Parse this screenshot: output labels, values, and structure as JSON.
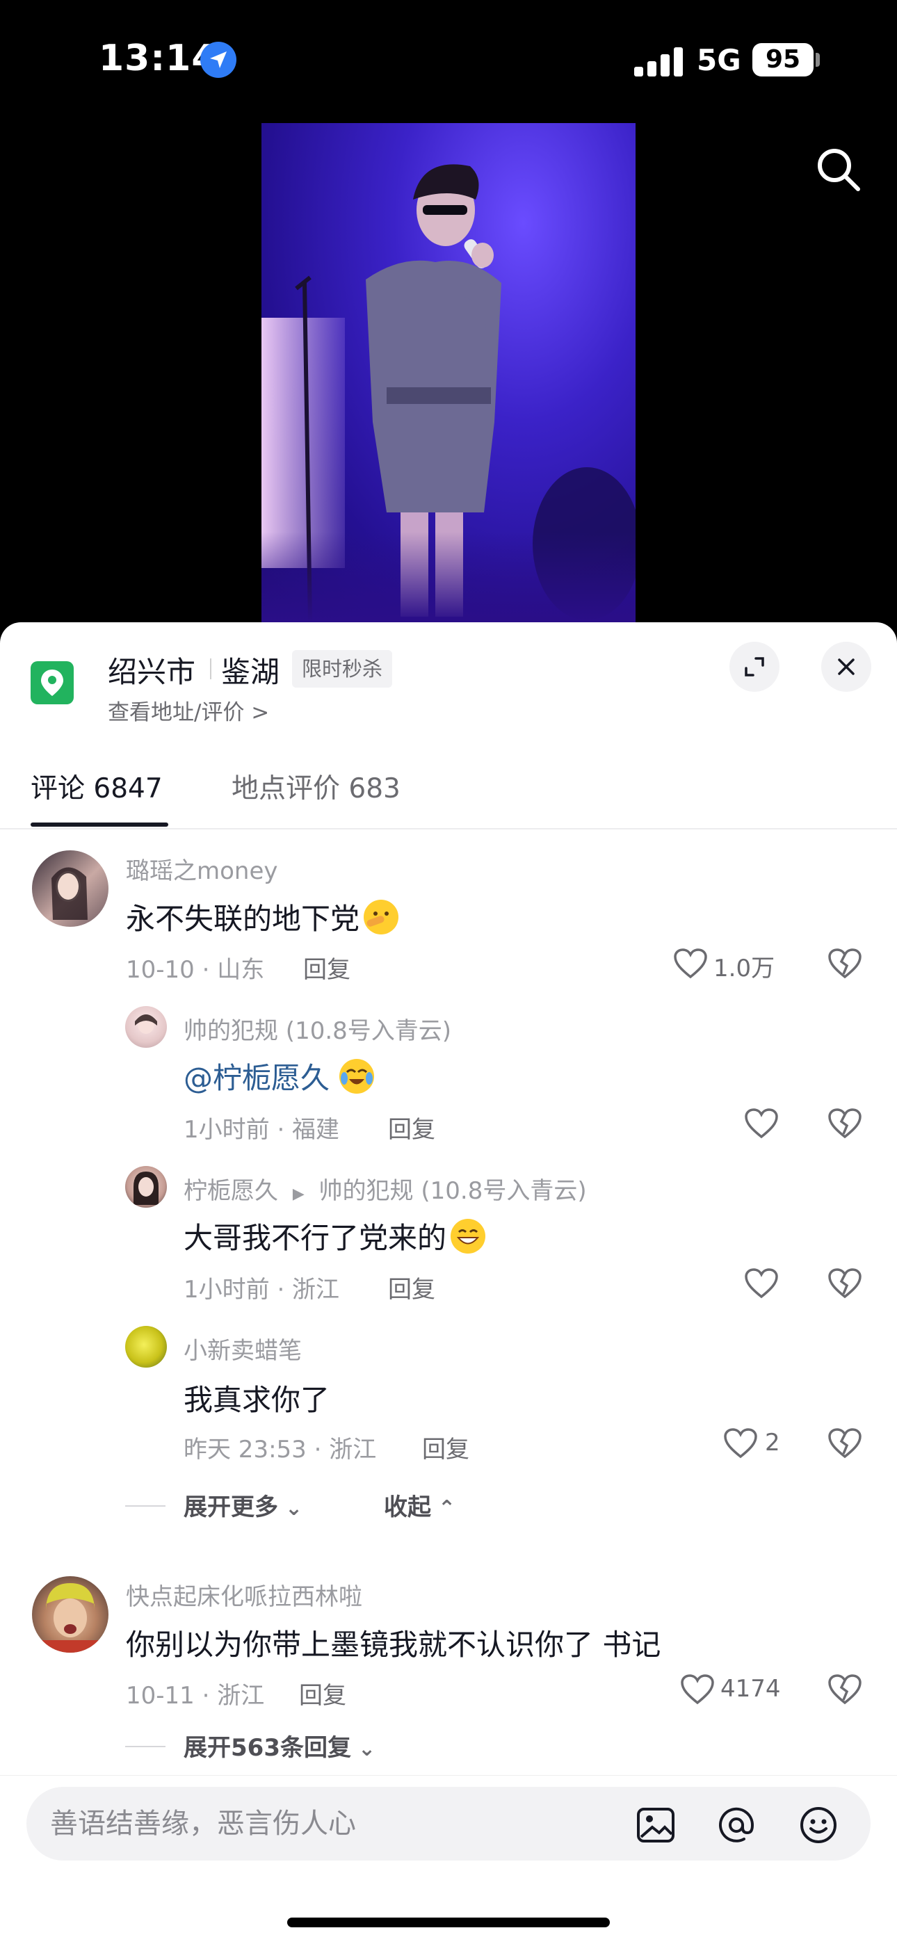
{
  "status_bar": {
    "time": "13:14",
    "network": "5G",
    "battery": "95"
  },
  "poi": {
    "city": "绍兴市",
    "area": "鉴湖",
    "tag": "限时秒杀",
    "link": "查看地址/评价 >"
  },
  "tabs": [
    {
      "label": "评论 6847"
    },
    {
      "label": "地点评价 683"
    }
  ],
  "comments": [
    {
      "user": "璐瑶之money",
      "text": "永不失联的地下党",
      "date": "10-10 · 山东",
      "reply": "回复",
      "likes": "1.0万"
    },
    {
      "user": "快点起床化哌拉西林啦",
      "text": "你别以为你带上墨镜我就不认识你了 书记",
      "date": "10-11 · 浙江",
      "reply": "回复",
      "likes": "4174"
    }
  ],
  "replies": [
    {
      "user": "帅的犯规 (10.8号入青云)",
      "text": "@柠栀愿久",
      "date": "1小时前 · 福建",
      "reply": "回复",
      "likes": ""
    },
    {
      "user": "柠栀愿久",
      "target": "帅的犯规 (10.8号入青云)",
      "text": "大哥我不行了党来的",
      "date": "1小时前 · 浙江",
      "reply": "回复",
      "likes": ""
    },
    {
      "user": "小新卖蜡笔",
      "text": "我真求你了",
      "date": "昨天 23:53 · 浙江",
      "reply": "回复",
      "likes": "2"
    }
  ],
  "fold": {
    "expand_more": "展开更多",
    "collapse": "收起",
    "expand_count": "展开563条回复"
  },
  "input": {
    "placeholder": "善语结善缘，恶言伤人心"
  },
  "colors": {
    "accent_blue": "#2c5d93",
    "poi_green": "#22b35e",
    "stage_purple": "#3b22c8"
  }
}
